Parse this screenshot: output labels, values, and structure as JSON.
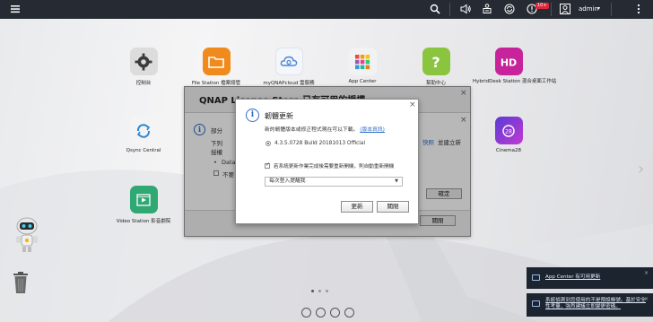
{
  "topbar": {
    "icons": [
      "menu-icon",
      "search-icon",
      "volume-icon",
      "task-icon",
      "sync-icon",
      "notification-icon",
      "user-icon"
    ],
    "notification_badge": "10+",
    "user": "admin"
  },
  "desktop_apps": [
    {
      "label": "控制台",
      "icon": "gear-icon",
      "color": "#d8d8d8"
    },
    {
      "label": "File Station 檔案總管",
      "icon": "folder-icon",
      "color": "#f08a1c"
    },
    {
      "label": "myQNAPcloud 雲服務",
      "icon": "cloud-icon",
      "color": "#f4f6fa"
    },
    {
      "label": "App Center",
      "icon": "grid-icon",
      "color": "#f2f2f2"
    },
    {
      "label": "幫助中心",
      "icon": "help-icon",
      "color": "#8bc43e"
    },
    {
      "label": "HybridDesk Station 混合桌面工作站",
      "icon": "hd-icon",
      "color": "#c7249b"
    },
    {
      "label": "Qsync Central",
      "icon": "qsync-icon",
      "color": "#f4f4f4"
    },
    {
      "label": "Cinema28",
      "icon": "cinema-icon",
      "color": "#8a4ad6"
    },
    {
      "label": "Video Station 影音劇院",
      "icon": "video-icon",
      "color": "#2fa874"
    }
  ],
  "license_window": {
    "title": "QNAP License Store 已有可用的授權",
    "line1_prefix": "部分",
    "line2": "下列",
    "line3": "授權",
    "bullet": "Data",
    "checkbox_prefix": "不要",
    "link_text": "快照",
    "suffix": "並建立新",
    "ok_button": "確定",
    "close_button": "關閉"
  },
  "firmware_dialog": {
    "title": "韌體更新",
    "description": "新的韌體版本或修正程式現在可以下載。",
    "details_link": "(版本資訊)",
    "version": "4.3.5.0728 Build 20181013 Official",
    "checkbox_label": "若系統更新作業完成後需要重新開機，則自動重新開機",
    "schedule_select": "每次登入提醒我",
    "update_button": "更新",
    "close_button": "關閉"
  },
  "notifications": [
    {
      "title": "App Center 有可用更新",
      "body": ""
    },
    {
      "title": "系統偵測到您使用的不是預設帳號。基於安全性考量，強烈建議立即變更密碼。",
      "body": ""
    }
  ]
}
